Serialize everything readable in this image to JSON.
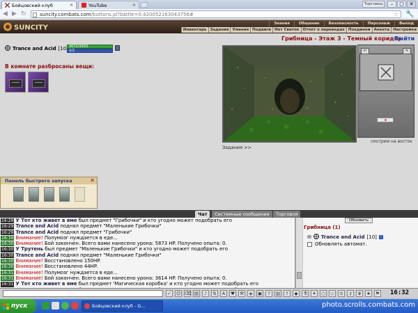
{
  "browser": {
    "tabs": [
      {
        "label": "Бойцовский клуб",
        "active": true
      },
      {
        "label": "YouTube",
        "active": false
      }
    ],
    "user_label": "Торговец",
    "url_host": "suncity.combats.com",
    "url_path": "/buttons.pl?battle=0.420052163043756#"
  },
  "game_header": {
    "logo_text": "SUNCITY",
    "menu_top": [
      "Знания",
      "Общение",
      "Безопасность",
      "Персонаж",
      "Выход"
    ],
    "menu_bottom": [
      "Инвентарь",
      "Задания",
      "Умения",
      "Подвиги",
      "Нет Свиток",
      "Отчет о переводах",
      "Поединки",
      "Анкета",
      "Настройки"
    ]
  },
  "character": {
    "name": "Trance and Acid",
    "level": "[10]",
    "hp": "3672/3933",
    "mp": "2/2"
  },
  "items": {
    "heading": "В комнате разбросаны вещи:",
    "count": 2
  },
  "location": {
    "title": "Грибница - Этаж 3 - Темный коридор",
    "exit_label": "Выйти",
    "facing": "смотрим на восток",
    "tasks_label": "Задания >>"
  },
  "quick_launch": {
    "title": "Панель быстрого запуска",
    "slots": 6
  },
  "chat_tabs": [
    "Чат",
    "Системные сообщения",
    "Торговля"
  ],
  "chat": {
    "lines": [
      {
        "ts": "16:29",
        "name": "У Тот кто живет в яме",
        "rest": " был предмет \"Грибочки\" и кто угодно может подобрать его",
        "warn": false,
        "green": false
      },
      {
        "ts": "16:29",
        "name": "Trance and Acid",
        "rest": " поднял предмет \"Маленькие Грибочки\"",
        "warn": false,
        "green": false
      },
      {
        "ts": "16:29",
        "name": "Trance and Acid",
        "rest": " поднял предмет \"Грибочки\"",
        "warn": false,
        "green": false
      },
      {
        "ts": "16:30",
        "name": "Внимание!",
        "rest": " Полумозг нуждается в еде...",
        "warn": true,
        "green": true
      },
      {
        "ts": "16:30",
        "name": "Внимание!",
        "rest": " Бой закончен. Всего вами нанесено урона: 5873 HP. Получено опыта: 0.",
        "warn": true,
        "green": true
      },
      {
        "ts": "16:30",
        "name": "У Трутень",
        "rest": " был предмет \"Маленькие Грибочки\" и кто угодно может подобрать его",
        "warn": false,
        "green": false
      },
      {
        "ts": "16:30",
        "name": "Trance and Acid",
        "rest": " поднял предмет \"Маленькие Грибочки\"",
        "warn": false,
        "green": false
      },
      {
        "ts": "16:30",
        "name": "Внимание!",
        "rest": " Восстановлено 150HP.",
        "warn": true,
        "green": true
      },
      {
        "ts": "16:30",
        "name": "Внимание!",
        "rest": " Восстановлено 44HP.",
        "warn": true,
        "green": true
      },
      {
        "ts": "16:31",
        "name": "Внимание!",
        "rest": " Полумозг нуждается в еде...",
        "warn": true,
        "green": true
      },
      {
        "ts": "16:31",
        "name": "Внимание!",
        "rest": " Бой закончен. Всего вами нанесено урона: 3614 HP. Получено опыта: 0.",
        "warn": true,
        "green": true
      },
      {
        "ts": "16:31",
        "name": "У Тот кто живет в яме",
        "rest": " был предмет 'Магическая коробка' и кто угодно может подобрать его",
        "warn": false,
        "green": false
      },
      {
        "ts": "16:31",
        "name": "У Тот кто живет в яме",
        "rest": " был предмет 'Магическая коробка' и кто угодно может подобрать его",
        "warn": false,
        "green": false
      }
    ]
  },
  "right_panel": {
    "refresh_label": "Обновить",
    "title": "Грибница (1)",
    "user": "Trance and Acid",
    "user_level": "[10]",
    "auto_label": "Обновлять автомат."
  },
  "input_bar": {
    "clock": "16:32"
  },
  "taskbar": {
    "start_label": "пуск",
    "task_label": "Бойцовский клуб - G...",
    "watermark": "photo.scrolls.combats.com"
  },
  "colors": {
    "header": "#3a2a1e",
    "location_title": "#8b0e0e",
    "link": "#1a3fa8",
    "taskbar": "#245ac4"
  }
}
